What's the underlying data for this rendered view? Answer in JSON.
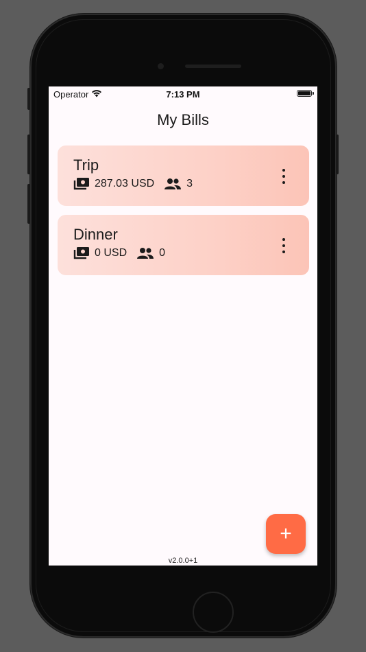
{
  "status_bar": {
    "carrier": "Operator",
    "time": "7:13 PM"
  },
  "app": {
    "title": "My Bills",
    "version": "v2.0.0+1",
    "accent_color": "#ff6b45",
    "card_gradient": [
      "#fde0db",
      "#fcc4b7"
    ]
  },
  "bills": [
    {
      "name": "Trip",
      "amount": "287.03 USD",
      "people": "3"
    },
    {
      "name": "Dinner",
      "amount": "0 USD",
      "people": "0"
    }
  ],
  "fab": {
    "label": "+",
    "icon": "add-icon"
  }
}
